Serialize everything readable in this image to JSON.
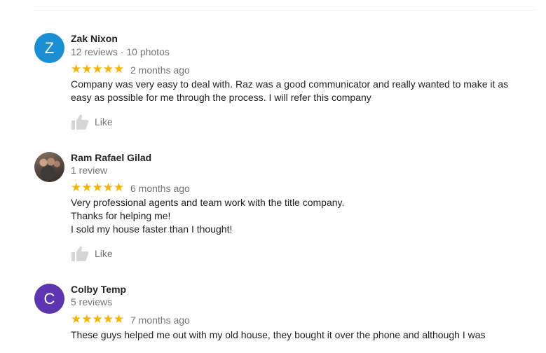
{
  "reviews": [
    {
      "name": "Zak Nixon",
      "avatar_letter": "Z",
      "avatar_color": "#1a8fd3",
      "meta": "12 reviews · 10 photos",
      "stars": "★★★★★",
      "date": "2 months ago",
      "text_lines": [
        "Company was very easy to deal with. Raz was a good communicator and really wanted to make it as",
        "easy as possible for me through the process. I will refer this company"
      ],
      "like_label": "Like"
    },
    {
      "name": "Ram Rafael Gilad",
      "avatar_letter": "",
      "avatar_color": "#6a5a50",
      "meta": "1 review",
      "stars": "★★★★★",
      "date": "6 months ago",
      "text_lines": [
        "Very professional agents and team work with the title company.",
        "Thanks for helping me!",
        "I sold my house faster than I thought!"
      ],
      "like_label": "Like"
    },
    {
      "name": "Colby Temp",
      "avatar_letter": "C",
      "avatar_color": "#5e35b1",
      "meta": "5 reviews",
      "stars": "★★★★★",
      "date": "7 months ago",
      "text_lines": [
        "These guys helped me out with my old house, they bought it over the phone and although I was"
      ],
      "like_label": ""
    }
  ]
}
